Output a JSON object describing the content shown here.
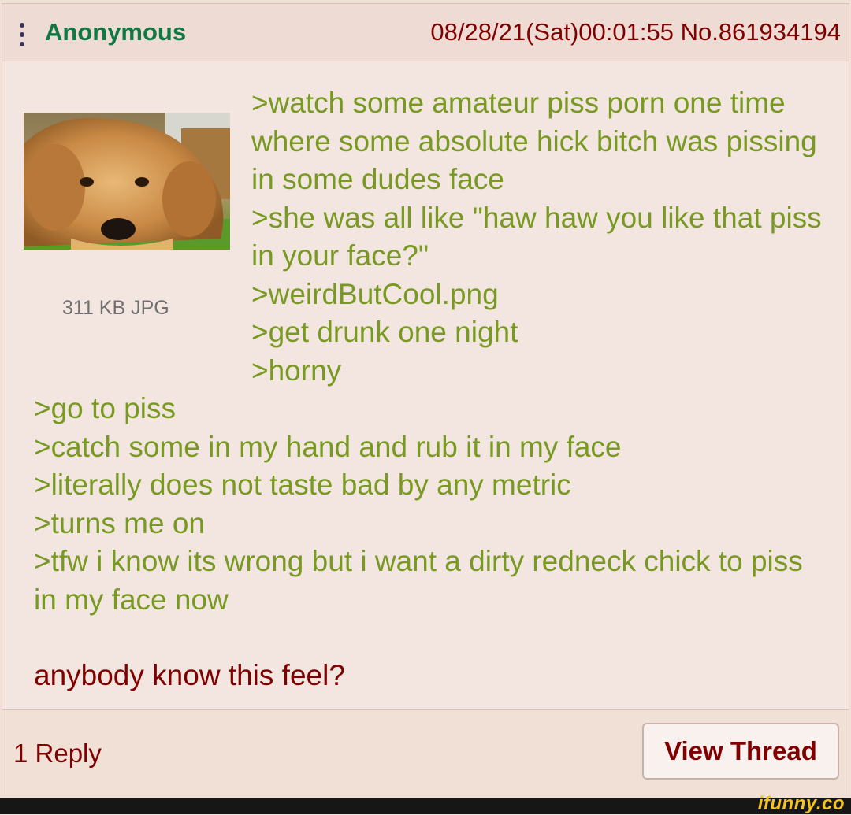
{
  "post": {
    "name": "Anonymous",
    "datetime": "08/28/21(Sat)00:01:55",
    "post_number": "No.861934194",
    "file_info": "311 KB JPG",
    "thumbnail_icon": "golden-retriever-thumbnail",
    "lines": [
      ">watch some amateur piss porn one time where some absolute hick bitch was pissing in some dudes face",
      ">she was all like \"haw haw you like that piss in your face?\"",
      ">weirdButCool.png",
      ">get drunk one night",
      ">horny",
      ">go to piss",
      ">catch some in my hand and rub it in my face",
      ">literally does not taste bad by any metric",
      ">turns me on",
      ">tfw i know its wrong but i want a dirty redneck chick to piss in my face now"
    ],
    "closing_text": "anybody know this feel?"
  },
  "footer": {
    "reply_count": "1 Reply",
    "view_thread_label": "View Thread"
  },
  "watermark": "ifunny.co",
  "colors": {
    "greentext": "#789922",
    "name": "#117743",
    "body": "#800000",
    "background": "#f0e0d6"
  }
}
